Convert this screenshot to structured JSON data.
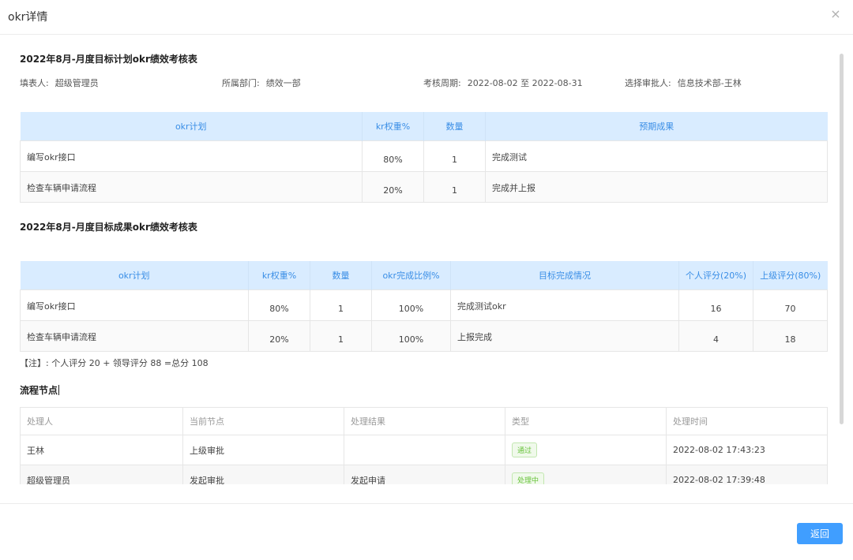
{
  "dialog": {
    "title": "okr详情",
    "close_icon": "×",
    "return_label": "返回"
  },
  "plan": {
    "title": "2022年8月-月度目标计划okr绩效考核表",
    "filler_label": "填表人:",
    "filler_value": "超级管理员",
    "dept_label": "所属部门:",
    "dept_value": "绩效一部",
    "period_label": "考核周期:",
    "period_value": "2022-08-02 至 2022-08-31",
    "approver_label": "选择审批人:",
    "approver_value": "信息技术部-王林",
    "headers": [
      "okr计划",
      "kr权重%",
      "数量",
      "预期成果"
    ],
    "rows": [
      {
        "plan": "编写okr接口",
        "weight": "80%",
        "qty": "1",
        "expected": "完成测试"
      },
      {
        "plan": "检查车辆申请流程",
        "weight": "20%",
        "qty": "1",
        "expected": "完成并上报"
      }
    ]
  },
  "result": {
    "title": "2022年8月-月度目标成果okr绩效考核表",
    "headers": [
      "okr计划",
      "kr权重%",
      "数量",
      "okr完成比例%",
      "目标完成情况",
      "个人评分(20%)",
      "上级评分(80%)"
    ],
    "rows": [
      {
        "plan": "编写okr接口",
        "weight": "80%",
        "qty": "1",
        "ratio": "100%",
        "status": "完成测试okr",
        "self": "16",
        "leader": "70"
      },
      {
        "plan": "检查车辆申请流程",
        "weight": "20%",
        "qty": "1",
        "ratio": "100%",
        "status": "上报完成",
        "self": "4",
        "leader": "18"
      }
    ],
    "note": "【注】: 个人评分 20 + 领导评分 88 =总分 108"
  },
  "flow": {
    "title": "流程节点",
    "headers": [
      "处理人",
      "当前节点",
      "处理结果",
      "类型",
      "处理时间"
    ],
    "rows": [
      {
        "handler": "王林",
        "node": "上级审批",
        "result": "",
        "type": "通过",
        "time": "2022-08-02 17:43:23"
      },
      {
        "handler": "超级管理员",
        "node": "发起审批",
        "result": "发起申请",
        "type": "处理中",
        "time": "2022-08-02 17:39:48"
      }
    ]
  }
}
